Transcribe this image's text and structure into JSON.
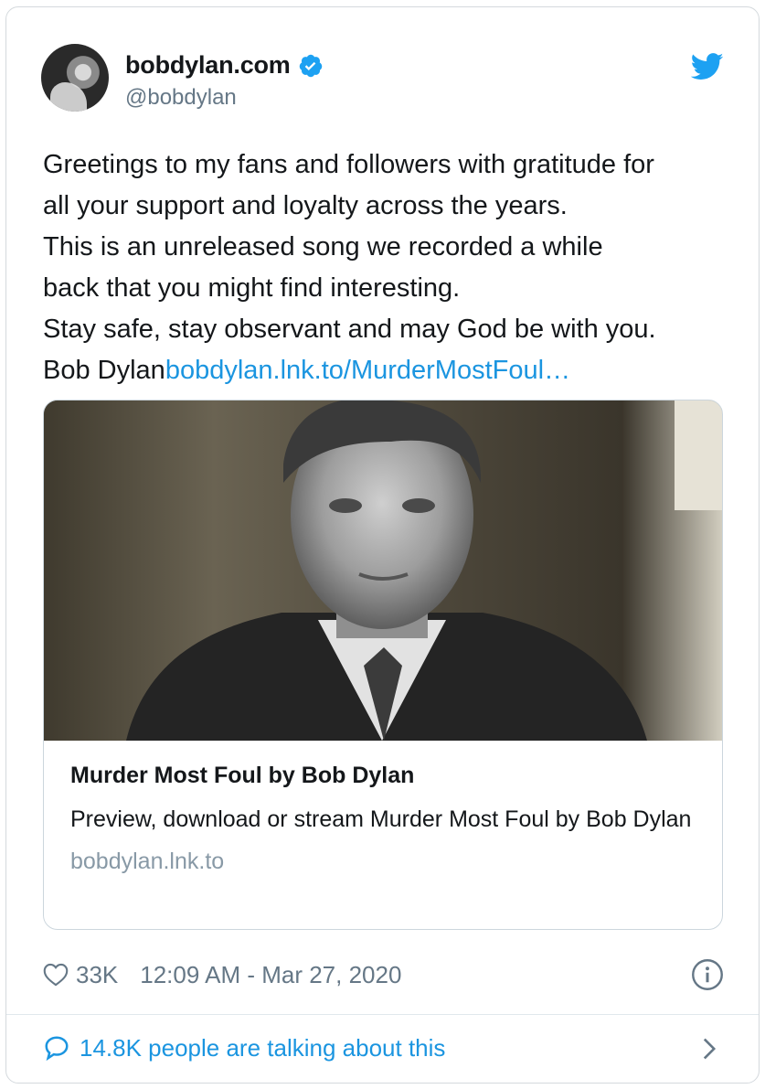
{
  "user": {
    "display_name": "bobdylan.com",
    "handle": "@bobdylan",
    "verified": true
  },
  "tweet": {
    "lines": [
      "Greetings to my fans and followers with gratitude for",
      "all your support and loyalty across the years.",
      "This is an unreleased song we recorded a while",
      "back that you might find interesting.",
      "Stay safe, stay observant and may God be with you."
    ],
    "last_line_text": "Bob Dylan",
    "link_text": "bobdylan.lnk.to/MurderMostFoul…"
  },
  "card": {
    "title": "Murder Most Foul by Bob Dylan",
    "description": "Preview, download or stream Murder Most Foul by Bob Dylan",
    "domain": "bobdylan.lnk.to"
  },
  "meta": {
    "likes": "33K",
    "timestamp": "12:09 AM - Mar 27, 2020"
  },
  "footer": {
    "talking": "14.8K people are talking about this"
  },
  "colors": {
    "link": "#1b95e0",
    "secondary_text": "#657786",
    "twitter_blue": "#1da1f2"
  }
}
